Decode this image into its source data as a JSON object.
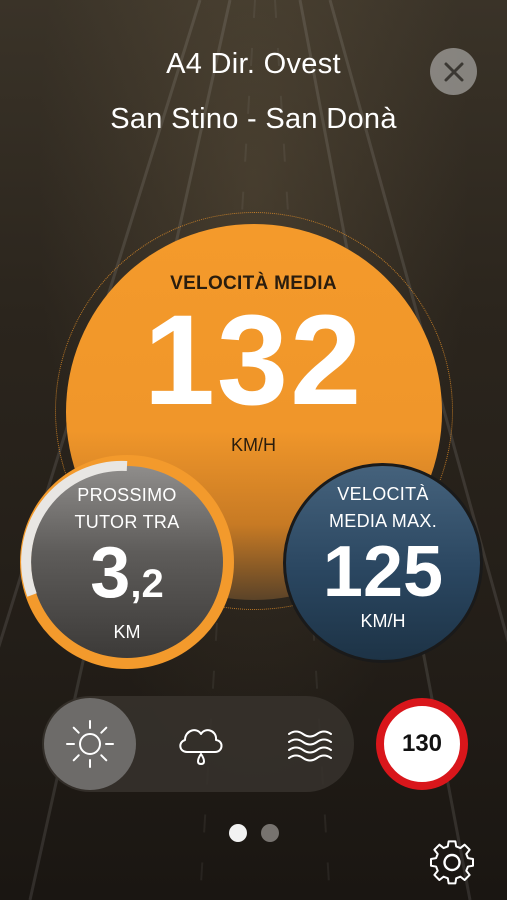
{
  "header": {
    "road": "A4 Dir. Ovest",
    "section": "San Stino - San Donà"
  },
  "average_speed": {
    "label": "VELOCITÀ MEDIA",
    "value": "132",
    "unit": "KM/H"
  },
  "next_tutor": {
    "label_line1": "PROSSIMO",
    "label_line2": "TUTOR TRA",
    "value_int": "3",
    "value_dec": ",2",
    "unit": "KM"
  },
  "max_average_speed": {
    "label_line1": "VELOCITÀ",
    "label_line2": "MEDIA MAX.",
    "value": "125",
    "unit": "KM/H"
  },
  "weather": {
    "options": [
      {
        "icon": "sun-icon",
        "selected": true
      },
      {
        "icon": "rain-cloud-icon",
        "selected": false
      },
      {
        "icon": "fog-icon",
        "selected": false
      }
    ]
  },
  "speed_limit": {
    "value": "130"
  },
  "pagination": {
    "pages": 2,
    "current": 1
  },
  "colors": {
    "accent": "#f39a2c",
    "limit_ring": "#d9161b",
    "max_circle": "#2a4660",
    "tutor_circle": "#5e5c5a"
  }
}
